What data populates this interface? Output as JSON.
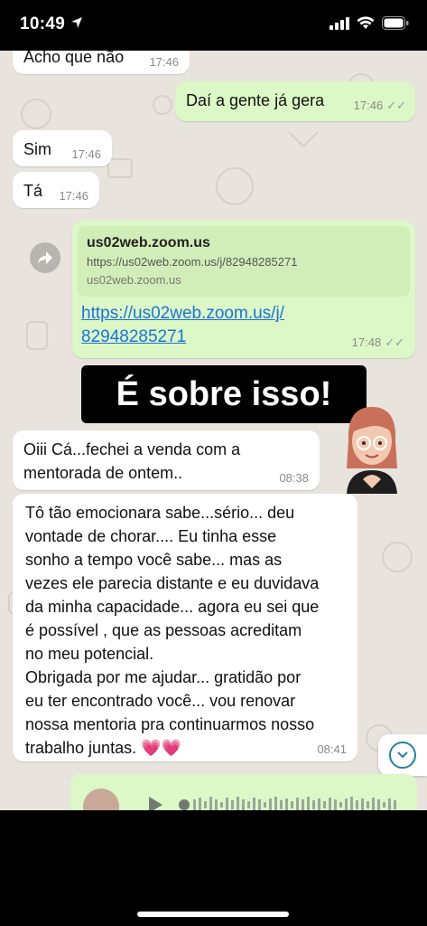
{
  "status": {
    "time": "10:49"
  },
  "messages": {
    "m0": {
      "text": "Acho que não",
      "time": "17:46"
    },
    "m1": {
      "text": "Daí a gente já gera",
      "time": "17:46"
    },
    "m2": {
      "text": "Sim",
      "time": "17:46"
    },
    "m3": {
      "text": "Tá",
      "time": "17:46"
    },
    "m4": {
      "preview_title": "us02web.zoom.us",
      "preview_url": "https://us02web.zoom.us/j/82948285271",
      "preview_domain": "us02web.zoom.us",
      "link_line1": "https://us02web.zoom.us/j/",
      "link_line2": "82948285271",
      "time": "17:48"
    },
    "banner": "É sobre isso!",
    "m5": {
      "line1": "Oiii Cá...fechei a venda com a",
      "line2": "mentorada de ontem..",
      "time": "08:38"
    },
    "m6": {
      "lines": [
        "Tô tão emocionara sabe...sério... deu",
        "vontade de chorar.... Eu tinha esse",
        "sonho a tempo você sabe... mas as",
        "vezes ele parecia distante e eu duvidava",
        "da minha capacidade... agora eu sei que",
        "é possível , que as pessoas acreditam",
        "no meu potencial.",
        "Obrigada por me ajudar... gratidão por",
        "eu ter encontrado você... vou renovar",
        "nossa mentoria pra continuarmos nosso",
        "trabalho juntas. 💗💗"
      ],
      "time": "08:41"
    }
  }
}
